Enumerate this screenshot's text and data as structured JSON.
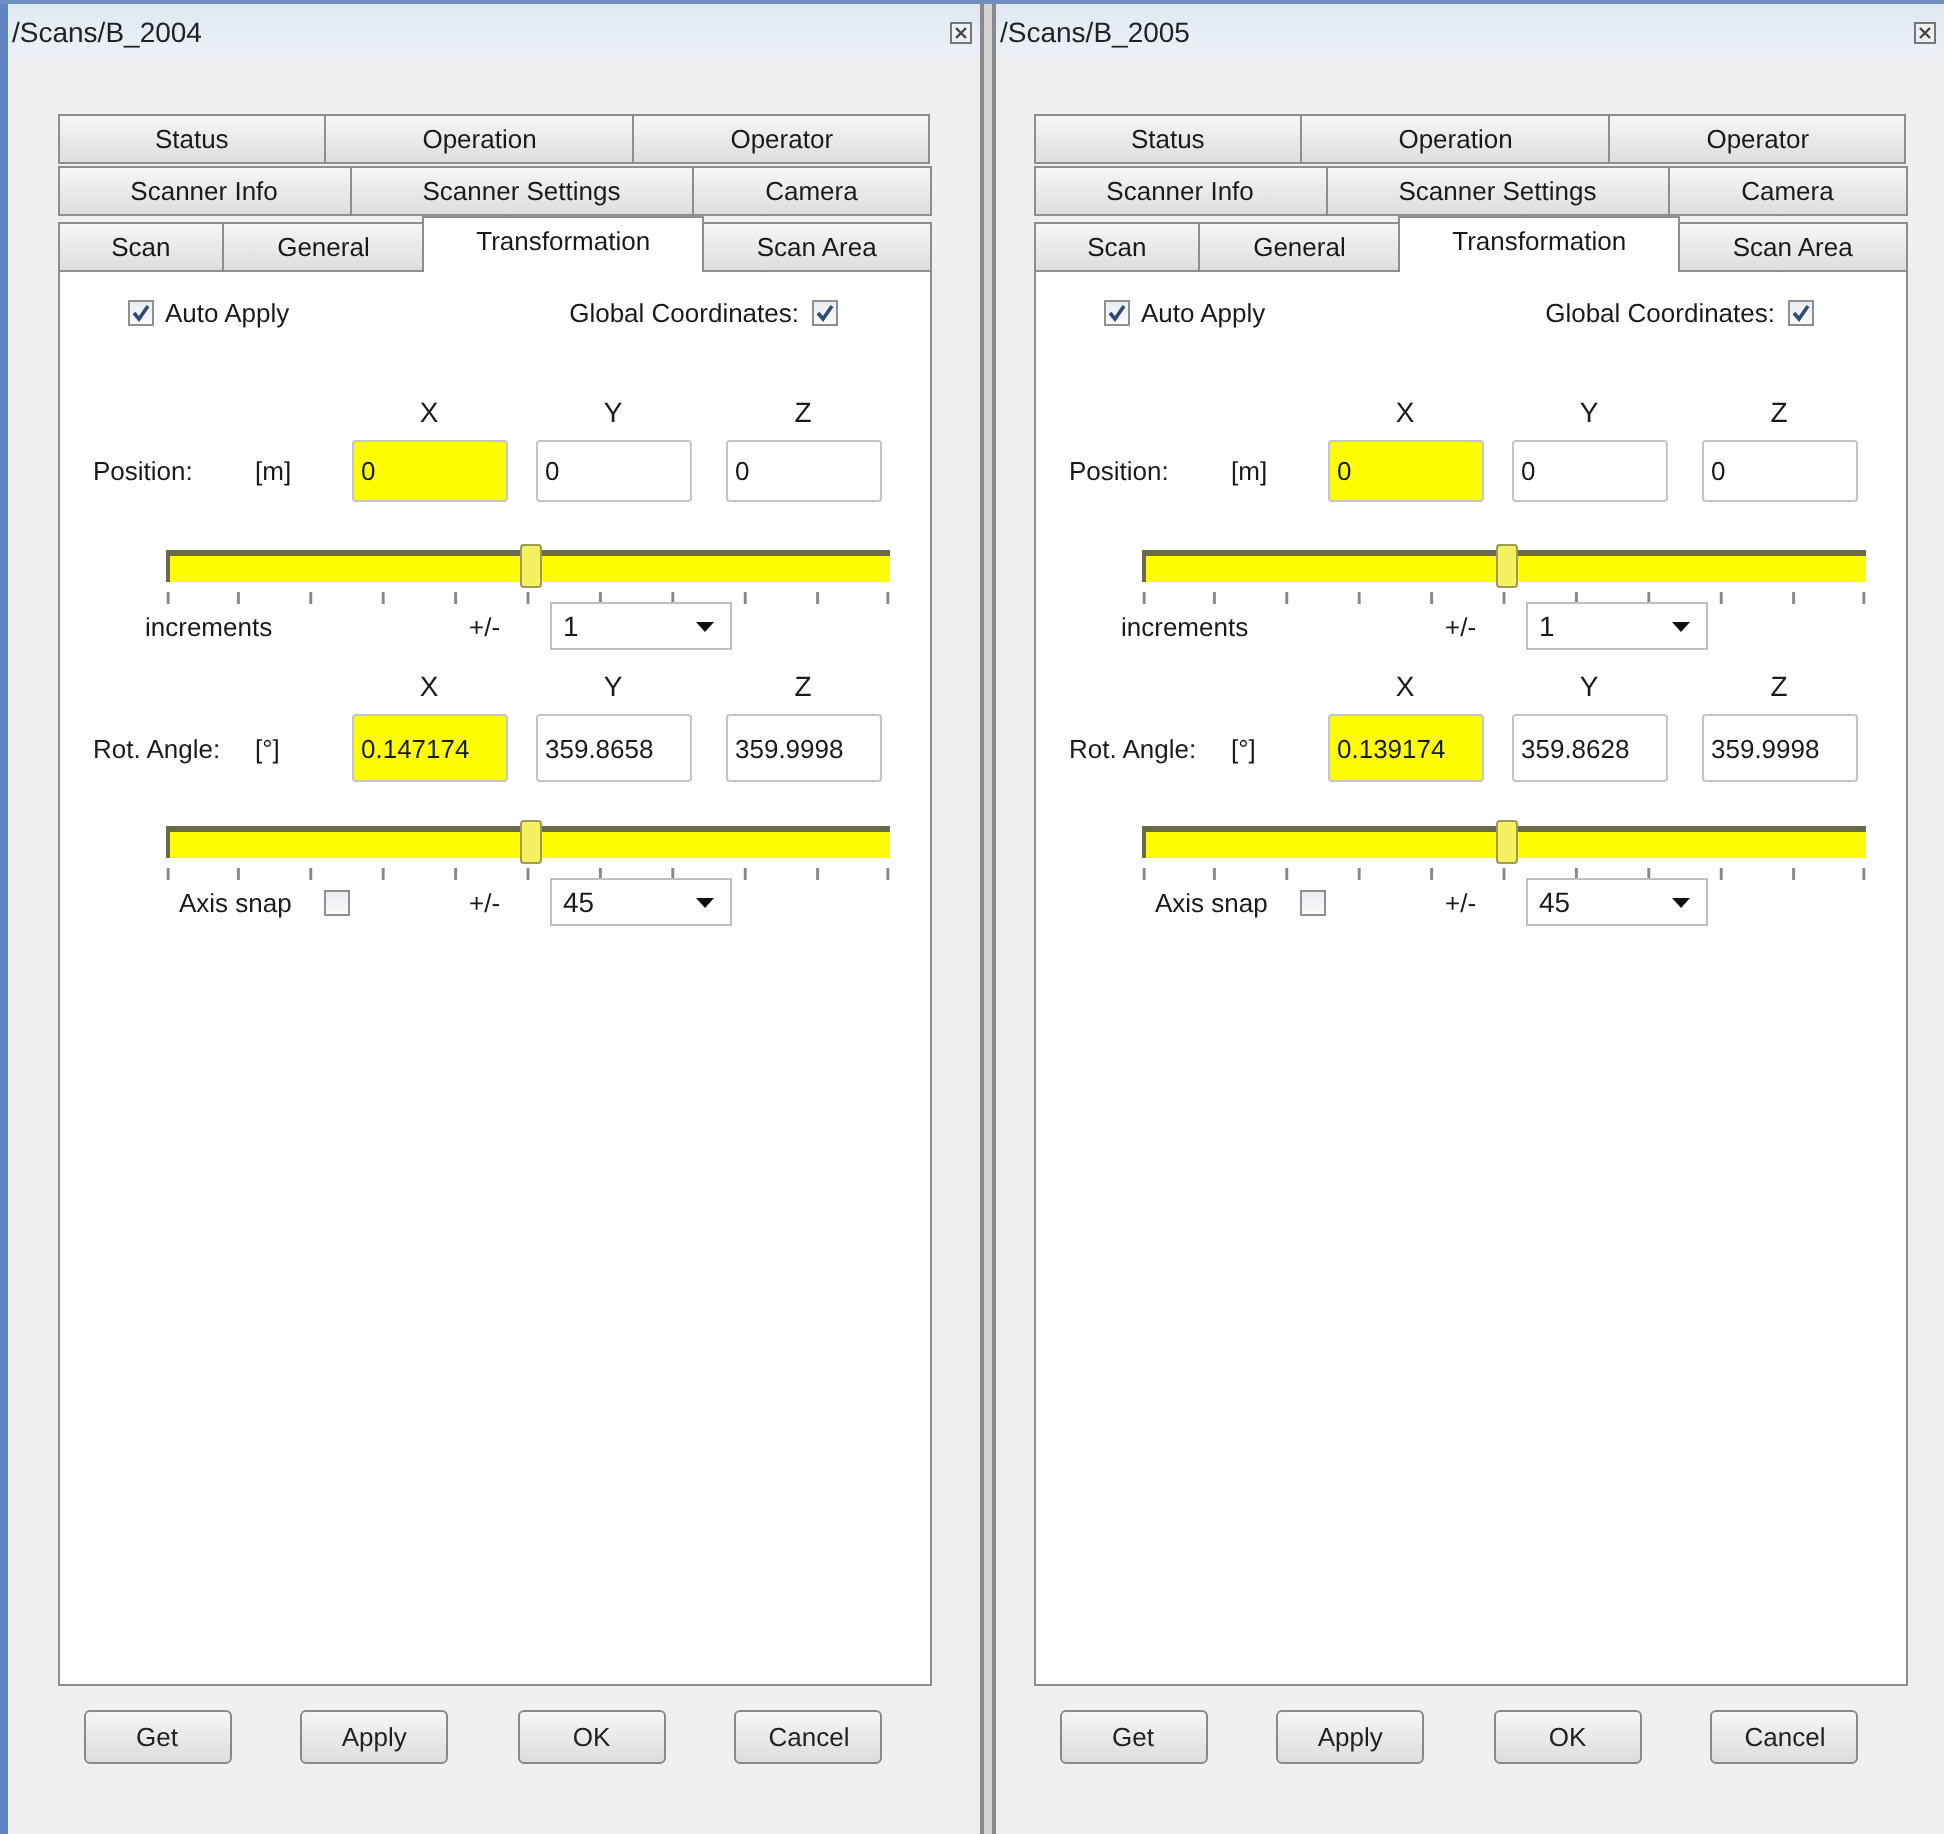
{
  "windows": [
    {
      "title": "/Scans/B_2004",
      "tab_rows": [
        [
          {
            "label": "Status",
            "selected": false
          },
          {
            "label": "Operation",
            "selected": false
          },
          {
            "label": "Operator",
            "selected": false
          }
        ],
        [
          {
            "label": "Scanner Info",
            "selected": false
          },
          {
            "label": "Scanner Settings",
            "selected": false
          },
          {
            "label": "Camera",
            "selected": false
          }
        ],
        [
          {
            "label": "Scan",
            "selected": false
          },
          {
            "label": "General",
            "selected": false
          },
          {
            "label": "Transformation",
            "selected": true
          },
          {
            "label": "Scan Area",
            "selected": false
          }
        ]
      ],
      "auto_apply": {
        "label": "Auto Apply",
        "checked": true
      },
      "global_coordinates": {
        "label": "Global Coordinates:",
        "checked": true
      },
      "position": {
        "axes": [
          "X",
          "Y",
          "Z"
        ],
        "label": "Position:",
        "unit": "[m]",
        "fields": [
          {
            "value": "0",
            "highlighted": true
          },
          {
            "value": "0",
            "highlighted": false
          },
          {
            "value": "0",
            "highlighted": false
          }
        ],
        "slider": {
          "level": 0.5
        }
      },
      "increments": {
        "label": "increments",
        "sign": "+/-",
        "value": "1"
      },
      "rotation": {
        "axes": [
          "X",
          "Y",
          "Z"
        ],
        "label": "Rot. Angle:",
        "unit": "[°]",
        "fields": [
          {
            "value": "0.147174",
            "highlighted": true
          },
          {
            "value": "359.8658",
            "highlighted": false
          },
          {
            "value": "359.9998",
            "highlighted": false
          }
        ],
        "slider": {
          "level": 0.5
        }
      },
      "axis_snap": {
        "label": "Axis snap",
        "checked": false,
        "sign": "+/-",
        "value": "45"
      },
      "buttons": [
        "Get",
        "Apply",
        "OK",
        "Cancel"
      ]
    },
    {
      "title": "/Scans/B_2005",
      "tab_rows": [
        [
          {
            "label": "Status",
            "selected": false
          },
          {
            "label": "Operation",
            "selected": false
          },
          {
            "label": "Operator",
            "selected": false
          }
        ],
        [
          {
            "label": "Scanner Info",
            "selected": false
          },
          {
            "label": "Scanner Settings",
            "selected": false
          },
          {
            "label": "Camera",
            "selected": false
          }
        ],
        [
          {
            "label": "Scan",
            "selected": false
          },
          {
            "label": "General",
            "selected": false
          },
          {
            "label": "Transformation",
            "selected": true
          },
          {
            "label": "Scan Area",
            "selected": false
          }
        ]
      ],
      "auto_apply": {
        "label": "Auto Apply",
        "checked": true
      },
      "global_coordinates": {
        "label": "Global Coordinates:",
        "checked": true
      },
      "position": {
        "axes": [
          "X",
          "Y",
          "Z"
        ],
        "label": "Position:",
        "unit": "[m]",
        "fields": [
          {
            "value": "0",
            "highlighted": true
          },
          {
            "value": "0",
            "highlighted": false
          },
          {
            "value": "0",
            "highlighted": false
          }
        ],
        "slider": {
          "level": 0.5
        }
      },
      "increments": {
        "label": "increments",
        "sign": "+/-",
        "value": "1"
      },
      "rotation": {
        "axes": [
          "X",
          "Y",
          "Z"
        ],
        "label": "Rot. Angle:",
        "unit": "[°]",
        "fields": [
          {
            "value": "0.139174",
            "highlighted": true
          },
          {
            "value": "359.8628",
            "highlighted": false
          },
          {
            "value": "359.9998",
            "highlighted": false
          }
        ],
        "slider": {
          "level": 0.5
        }
      },
      "axis_snap": {
        "label": "Axis snap",
        "checked": false,
        "sign": "+/-",
        "value": "45"
      },
      "buttons": [
        "Get",
        "Apply",
        "OK",
        "Cancel"
      ]
    }
  ]
}
